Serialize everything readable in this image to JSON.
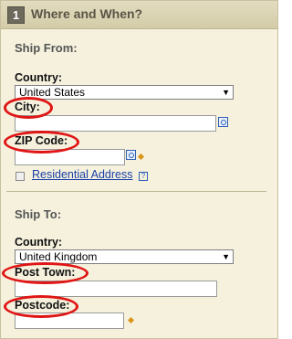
{
  "header": {
    "step_number": "1",
    "title": "Where and When?"
  },
  "ship_from": {
    "title": "Ship From:",
    "country_label": "Country:",
    "country_value": "United States",
    "city_label": "City:",
    "city_value": "",
    "zip_label": "ZIP Code:",
    "zip_value": "",
    "residential_label": "Residential Address",
    "residential_checked": false,
    "help_icon_text": "?"
  },
  "ship_to": {
    "title": "Ship To:",
    "country_label": "Country:",
    "country_value": "United Kingdom",
    "post_town_label": "Post Town:",
    "post_town_value": "",
    "postcode_label": "Postcode:",
    "postcode_value": ""
  },
  "colors": {
    "panel_bg": "#f5f1dd",
    "header_bg": "#d4cca8",
    "link": "#1a3fa8",
    "highlight_oval": "#e01515",
    "required_marker": "#d9961a"
  }
}
